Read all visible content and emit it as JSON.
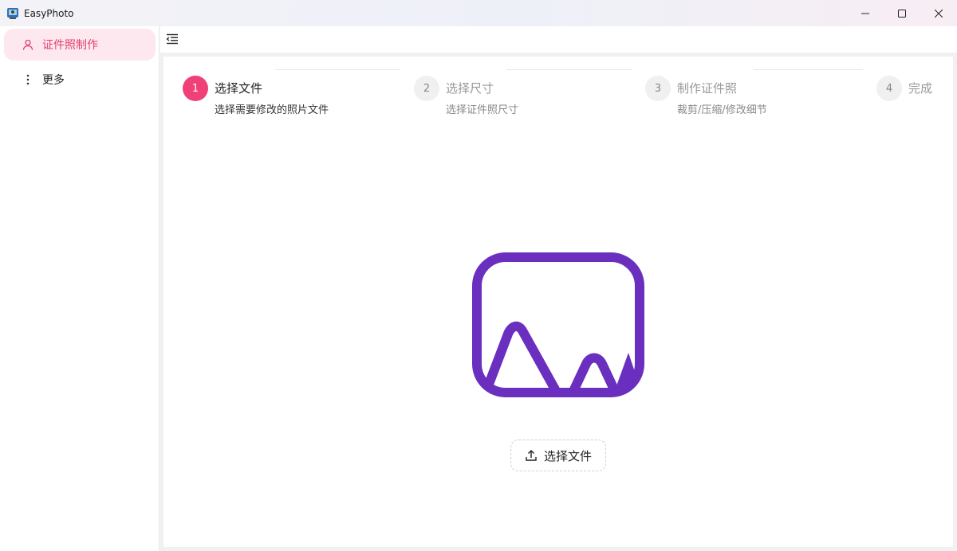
{
  "window": {
    "title": "EasyPhoto",
    "icon": "app-photo-icon",
    "controls": [
      "minimize-icon",
      "maximize-icon",
      "close-icon"
    ]
  },
  "sidebar": {
    "items": [
      {
        "label": "证件照制作",
        "icon": "user-icon",
        "active": true
      },
      {
        "label": "更多",
        "icon": "more-vertical-icon",
        "active": false
      }
    ]
  },
  "toolbar": {
    "menu_icon": "menu-fold-icon"
  },
  "steps": [
    {
      "number": "1",
      "title": "选择文件",
      "description": "选择需要修改的照片文件",
      "active": true
    },
    {
      "number": "2",
      "title": "选择尺寸",
      "description": "选择证件照尺寸",
      "active": false
    },
    {
      "number": "3",
      "title": "制作证件照",
      "description": "裁剪/压缩/修改细节",
      "active": false
    },
    {
      "number": "4",
      "title": "完成",
      "description": "",
      "active": false
    }
  ],
  "main": {
    "placeholder_icon": "image-placeholder-icon",
    "upload_button": {
      "label": "选择文件",
      "icon": "upload-icon"
    }
  },
  "colors": {
    "accent": "#ef4178",
    "accent_light": "#fde8ef",
    "placeholder": "#6a2fbf"
  }
}
